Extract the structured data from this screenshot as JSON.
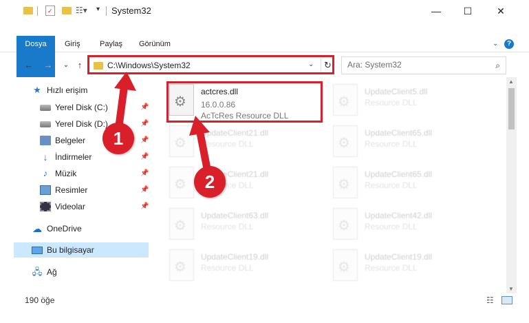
{
  "window": {
    "title": "System32",
    "minimize": "—",
    "maximize": "☐",
    "close": "✕"
  },
  "ribbon": {
    "tabs": [
      "Dosya",
      "Giriş",
      "Paylaş",
      "Görünüm"
    ],
    "help": "?"
  },
  "address": {
    "path": "C:\\Windows\\System32",
    "dropdown": "⌄",
    "refresh": "↻"
  },
  "search": {
    "placeholder": "Ara: System32"
  },
  "nav": {
    "back": "←",
    "forward": "→",
    "recent": "⌄",
    "up": "↑",
    "items": [
      {
        "label": "Hızlı erişim",
        "icon": "star-icon"
      },
      {
        "label": "Yerel Disk (C:)",
        "icon": "disk-icon"
      },
      {
        "label": "Yerel Disk (D:)",
        "icon": "disk-icon"
      },
      {
        "label": "Belgeler",
        "icon": "documents-icon"
      },
      {
        "label": "İndirmeler",
        "icon": "download-icon"
      },
      {
        "label": "Müzik",
        "icon": "music-icon"
      },
      {
        "label": "Resimler",
        "icon": "pictures-icon"
      },
      {
        "label": "Videolar",
        "icon": "videos-icon"
      },
      {
        "label": "OneDrive",
        "icon": "cloud-icon"
      },
      {
        "label": "Bu bilgisayar",
        "icon": "computer-icon"
      },
      {
        "label": "Ağ",
        "icon": "network-icon"
      }
    ]
  },
  "files": {
    "main": {
      "name": "actcres.dll",
      "version": "16.0.0.86",
      "description": "AcTcRes Resource DLL"
    },
    "faded": [
      {
        "name": "UpdateClient5.dll",
        "desc": "Resource DLL"
      },
      {
        "name": "UpdateClient21.dll",
        "desc": "Resource DLL"
      },
      {
        "name": "UpdateClient65.dll",
        "desc": "Resource DLL"
      },
      {
        "name": "UpdateClient21.dll",
        "desc": "Resource DLL"
      },
      {
        "name": "UpdateClient65.dll",
        "desc": "Resource DLL"
      },
      {
        "name": "UpdateClient63.dll",
        "desc": "Resource DLL"
      },
      {
        "name": "UpdateClient42.dll",
        "desc": "Resource DLL"
      },
      {
        "name": "UpdateClient19.dll",
        "desc": "Resource DLL"
      },
      {
        "name": "UpdateClient19.dll",
        "desc": "Resource DLL"
      }
    ]
  },
  "status": {
    "count": "190 öğe"
  },
  "annotations": {
    "badge1": "1",
    "badge2": "2",
    "color": "#d9202a"
  }
}
